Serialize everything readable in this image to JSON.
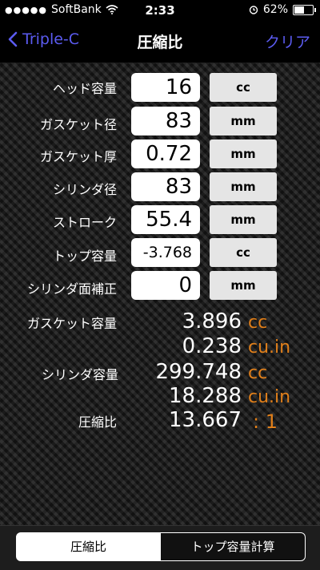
{
  "status_bar": {
    "carrier": "SoftBank",
    "time": "2:33",
    "battery": "62%",
    "battery_level": 0.62
  },
  "nav": {
    "back_label": "Triple-C",
    "title": "圧縮比",
    "clear_label": "クリア"
  },
  "inputs": [
    {
      "label": "ヘッド容量",
      "value": "16",
      "unit": "cc"
    },
    {
      "label": "ガスケット径",
      "value": "83",
      "unit": "mm"
    },
    {
      "label": "ガスケット厚",
      "value": "0.72",
      "unit": "mm"
    },
    {
      "label": "シリンダ径",
      "value": "83",
      "unit": "mm"
    },
    {
      "label": "ストローク",
      "value": "55.4",
      "unit": "mm"
    },
    {
      "label": "トップ容量",
      "value": "-3.768",
      "unit": "cc"
    },
    {
      "label": "シリンダ面補正",
      "value": "0",
      "unit": "mm"
    }
  ],
  "results": {
    "gasket_volume": {
      "label": "ガスケット容量",
      "value_cc": "3.896",
      "unit_cc": "cc",
      "value_cuin": "0.238",
      "unit_cuin": "cu.in"
    },
    "cylinder_volume": {
      "label": "シリンダ容量",
      "value_cc": "299.748",
      "unit_cc": "cc",
      "value_cuin": "18.288",
      "unit_cuin": "cu.in"
    },
    "compression_ratio": {
      "label": "圧縮比",
      "value": "13.667",
      "unit": ": 1"
    }
  },
  "tabs": [
    {
      "label": "圧縮比",
      "active": true
    },
    {
      "label": "トップ容量計算",
      "active": false
    }
  ],
  "colors": {
    "accent": "#5b5bf0",
    "result_unit": "#e07f1a"
  }
}
